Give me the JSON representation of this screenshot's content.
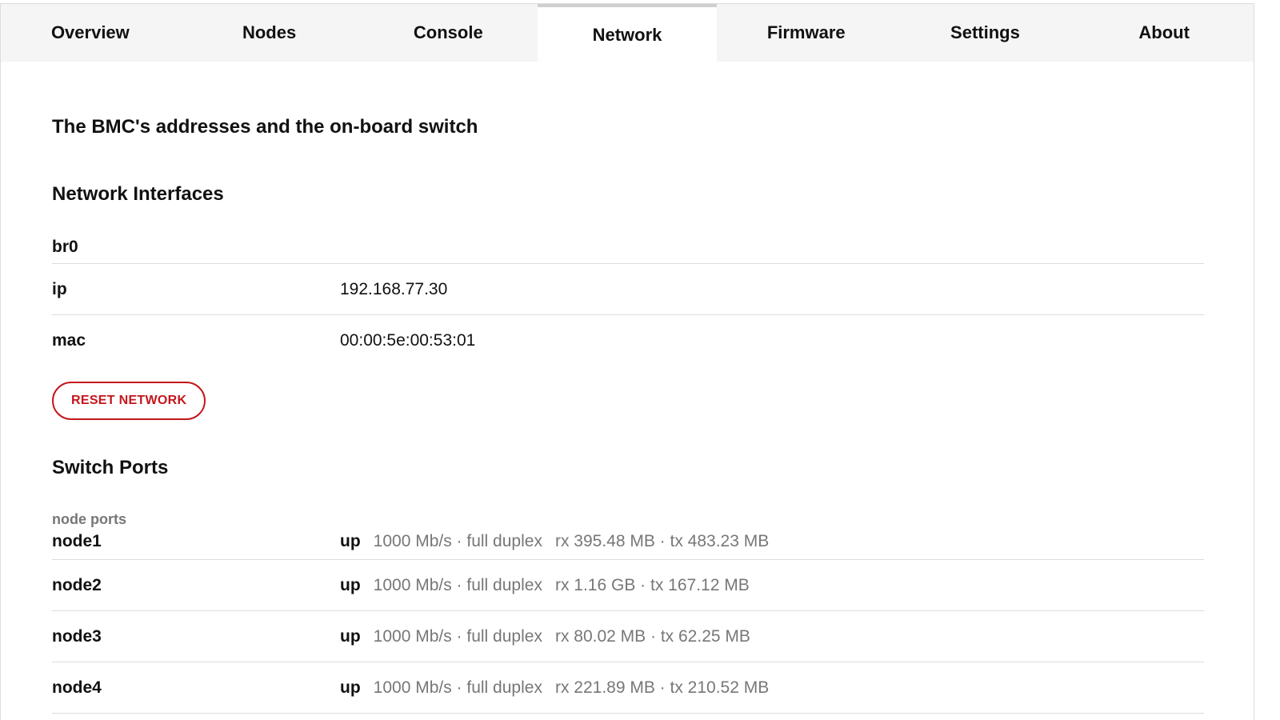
{
  "tabs": [
    {
      "label": "Overview"
    },
    {
      "label": "Nodes"
    },
    {
      "label": "Console"
    },
    {
      "label": "Network"
    },
    {
      "label": "Firmware"
    },
    {
      "label": "Settings"
    },
    {
      "label": "About"
    }
  ],
  "active_tab": "Network",
  "page": {
    "subtitle": "The BMC's addresses and the on-board switch"
  },
  "interfaces": {
    "title": "Network Interfaces",
    "name": "br0",
    "rows": [
      {
        "key": "ip",
        "value": "192.168.77.30"
      },
      {
        "key": "mac",
        "value": "00:00:5e:00:53:01"
      }
    ],
    "reset_label": "RESET NETWORK"
  },
  "switch": {
    "title": "Switch Ports",
    "group_label": "node ports",
    "ports": [
      {
        "name": "node1",
        "status": "up",
        "speed": "1000 Mb/s · full duplex",
        "traffic": "rx 395.48 MB · tx 483.23 MB"
      },
      {
        "name": "node2",
        "status": "up",
        "speed": "1000 Mb/s · full duplex",
        "traffic": "rx 1.16 GB · tx 167.12 MB"
      },
      {
        "name": "node3",
        "status": "up",
        "speed": "1000 Mb/s · full duplex",
        "traffic": "rx 80.02 MB · tx 62.25 MB"
      },
      {
        "name": "node4",
        "status": "up",
        "speed": "1000 Mb/s · full duplex",
        "traffic": "rx 221.89 MB · tx 210.52 MB"
      }
    ]
  },
  "colors": {
    "accent_red": "#c4161c",
    "tabbar_bg": "#f5f5f5",
    "muted_text": "#777777"
  }
}
